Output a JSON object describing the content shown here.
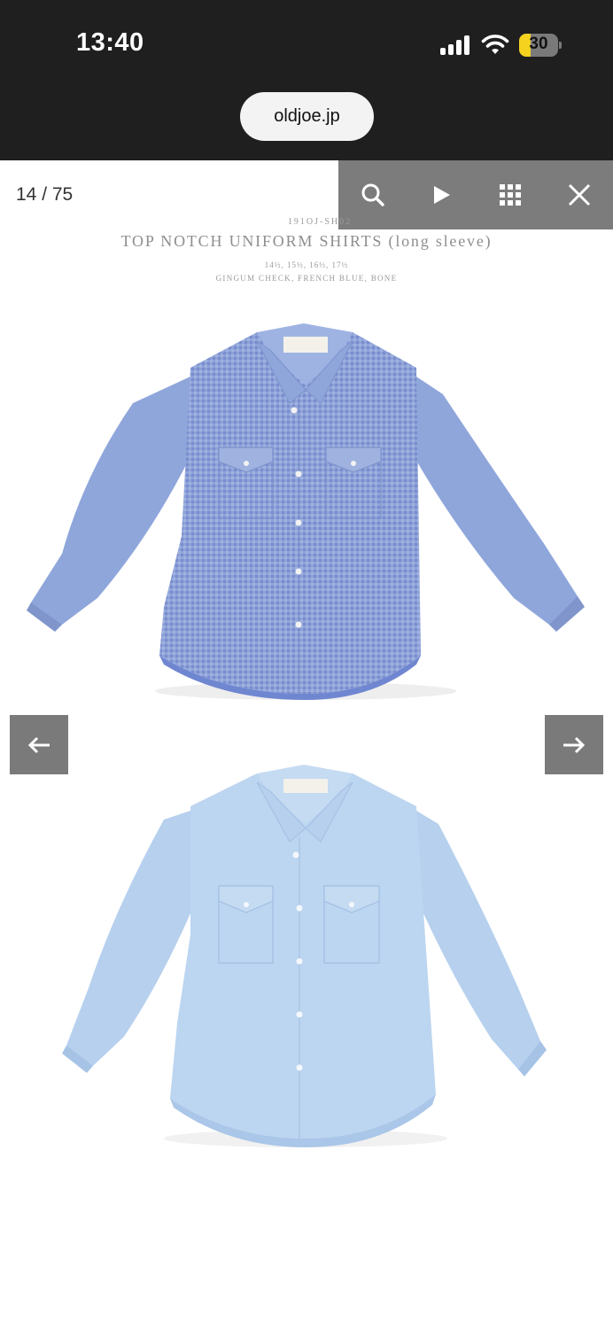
{
  "status_bar": {
    "time": "13:40",
    "battery_level": "30",
    "battery_fraction": 0.3,
    "battery_color": "#f4d21e"
  },
  "browser": {
    "url": "oldjoe.jp"
  },
  "gallery": {
    "counter": "14 / 75",
    "toolbar_icons": [
      "search-icon",
      "play-icon",
      "grid-icon",
      "close-icon"
    ],
    "nav_icons": [
      "arrow-left-icon",
      "arrow-right-icon"
    ]
  },
  "product": {
    "code": "191OJ-SH02",
    "title": "TOP NOTCH UNIFORM SHIRTS (long sleeve)",
    "sizes": "14½, 15½, 16½, 17½",
    "colors": "GINGUM CHECK, FRENCH BLUE, BONE",
    "images": [
      {
        "name": "gingham check shirt",
        "color": "#8fa6db"
      },
      {
        "name": "french blue shirt",
        "color": "#b9d3ef"
      }
    ]
  }
}
